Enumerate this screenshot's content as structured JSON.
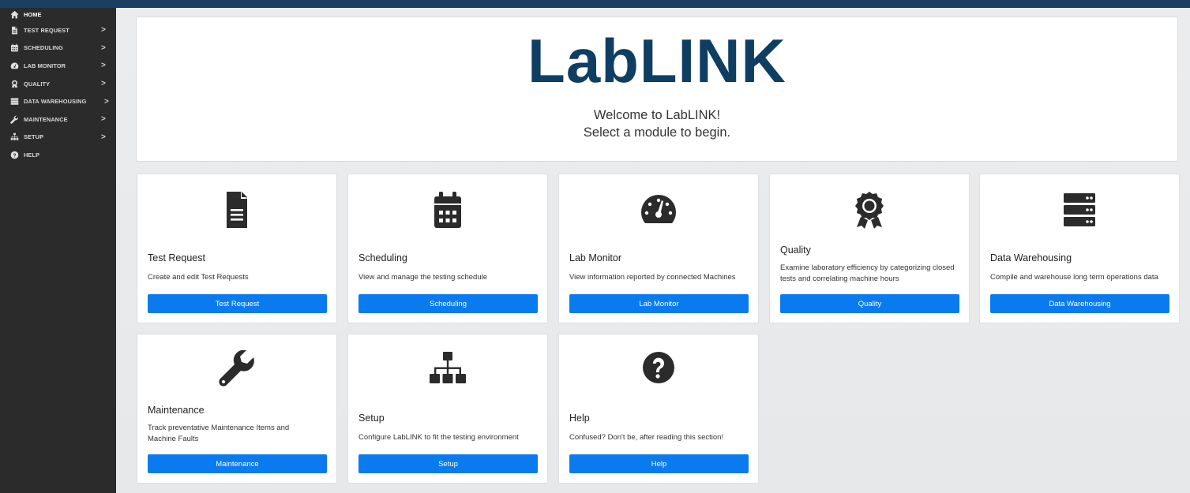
{
  "sidebar": {
    "items": [
      {
        "label": "HOME",
        "icon": "home-icon",
        "chevron": ""
      },
      {
        "label": "TEST REQUEST",
        "icon": "file-icon",
        "chevron": ">"
      },
      {
        "label": "SCHEDULING",
        "icon": "calendar-icon",
        "chevron": ">"
      },
      {
        "label": "LAB MONITOR",
        "icon": "gauge-icon",
        "chevron": ">"
      },
      {
        "label": "QUALITY",
        "icon": "award-icon",
        "chevron": ">"
      },
      {
        "label": "DATA WAREHOUSING",
        "icon": "server-icon",
        "chevron": ">"
      },
      {
        "label": "MAINTENANCE",
        "icon": "wrench-icon",
        "chevron": ">"
      },
      {
        "label": "SETUP",
        "icon": "sitemap-icon",
        "chevron": ">"
      },
      {
        "label": "HELP",
        "icon": "help-icon",
        "chevron": ""
      }
    ]
  },
  "hero": {
    "logo": "LabLINK",
    "welcome_line1": "Welcome to LabLINK!",
    "welcome_line2": "Select a module to begin."
  },
  "cards": [
    {
      "title": "Test Request",
      "desc": "Create and edit Test Requests",
      "button": "Test Request",
      "icon": "file-icon"
    },
    {
      "title": "Scheduling",
      "desc": "View and manage the testing schedule",
      "button": "Scheduling",
      "icon": "calendar-icon"
    },
    {
      "title": "Lab Monitor",
      "desc": "View information reported by connected Machines",
      "button": "Lab Monitor",
      "icon": "gauge-icon"
    },
    {
      "title": "Quality",
      "desc": "Examine laboratory efficiency by categorizing closed tests and correlating machine hours",
      "button": "Quality",
      "icon": "award-icon"
    },
    {
      "title": "Data Warehousing",
      "desc": "Compile and warehouse long term operations data",
      "button": "Data Warehousing",
      "icon": "server-icon"
    },
    {
      "title": "Maintenance",
      "desc": "Track preventative Maintenance Items and Machine Faults",
      "button": "Maintenance",
      "icon": "wrench-icon"
    },
    {
      "title": "Setup",
      "desc": "Configure LabLINK to fit the testing environment",
      "button": "Setup",
      "icon": "sitemap-icon"
    },
    {
      "title": "Help",
      "desc": "Confused? Don't be, after reading this section!",
      "button": "Help",
      "icon": "help-icon"
    }
  ],
  "colors": {
    "topbar": "#1b3f63",
    "sidebar": "#2b2b2b",
    "logo": "#0f3e63",
    "button": "#0a7bef"
  }
}
